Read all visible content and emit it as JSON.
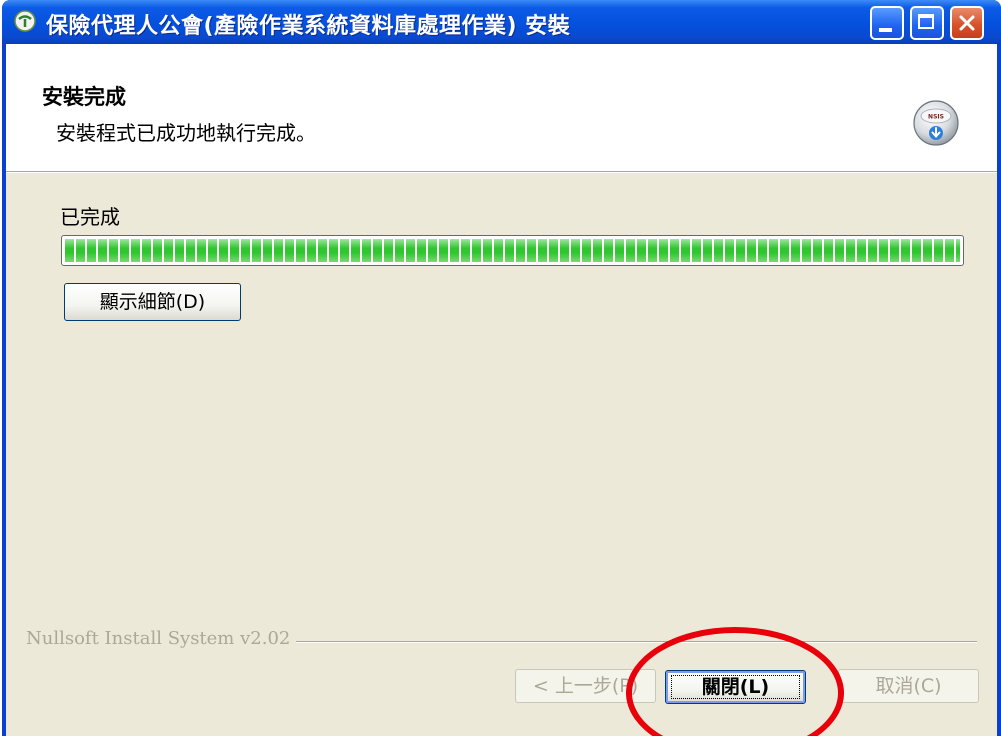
{
  "window": {
    "title": "保險代理人公會(產險作業系統資料庫處理作業) 安裝",
    "icons": {
      "app": "app-icon",
      "minimize": "minimize-icon",
      "maximize": "maximize-icon",
      "close": "close-icon"
    }
  },
  "header": {
    "title": "安裝完成",
    "subtitle": "安裝程式已成功地執行完成。",
    "icon": "installer-disc-icon"
  },
  "main": {
    "status_label": "已完成",
    "progress_fraction": 1.0,
    "details_button": "顯示細節(D)"
  },
  "footer": {
    "branding": "Nullsoft Install System v2.02",
    "back_button": "< 上一步(P)",
    "close_button": "關閉(L)",
    "cancel_button": "取消(C)"
  },
  "colors": {
    "titlebar": "#0451de",
    "progress": "#2fc62f",
    "annotation": "#e8000a",
    "dialog_bg": "#ece9d8"
  }
}
